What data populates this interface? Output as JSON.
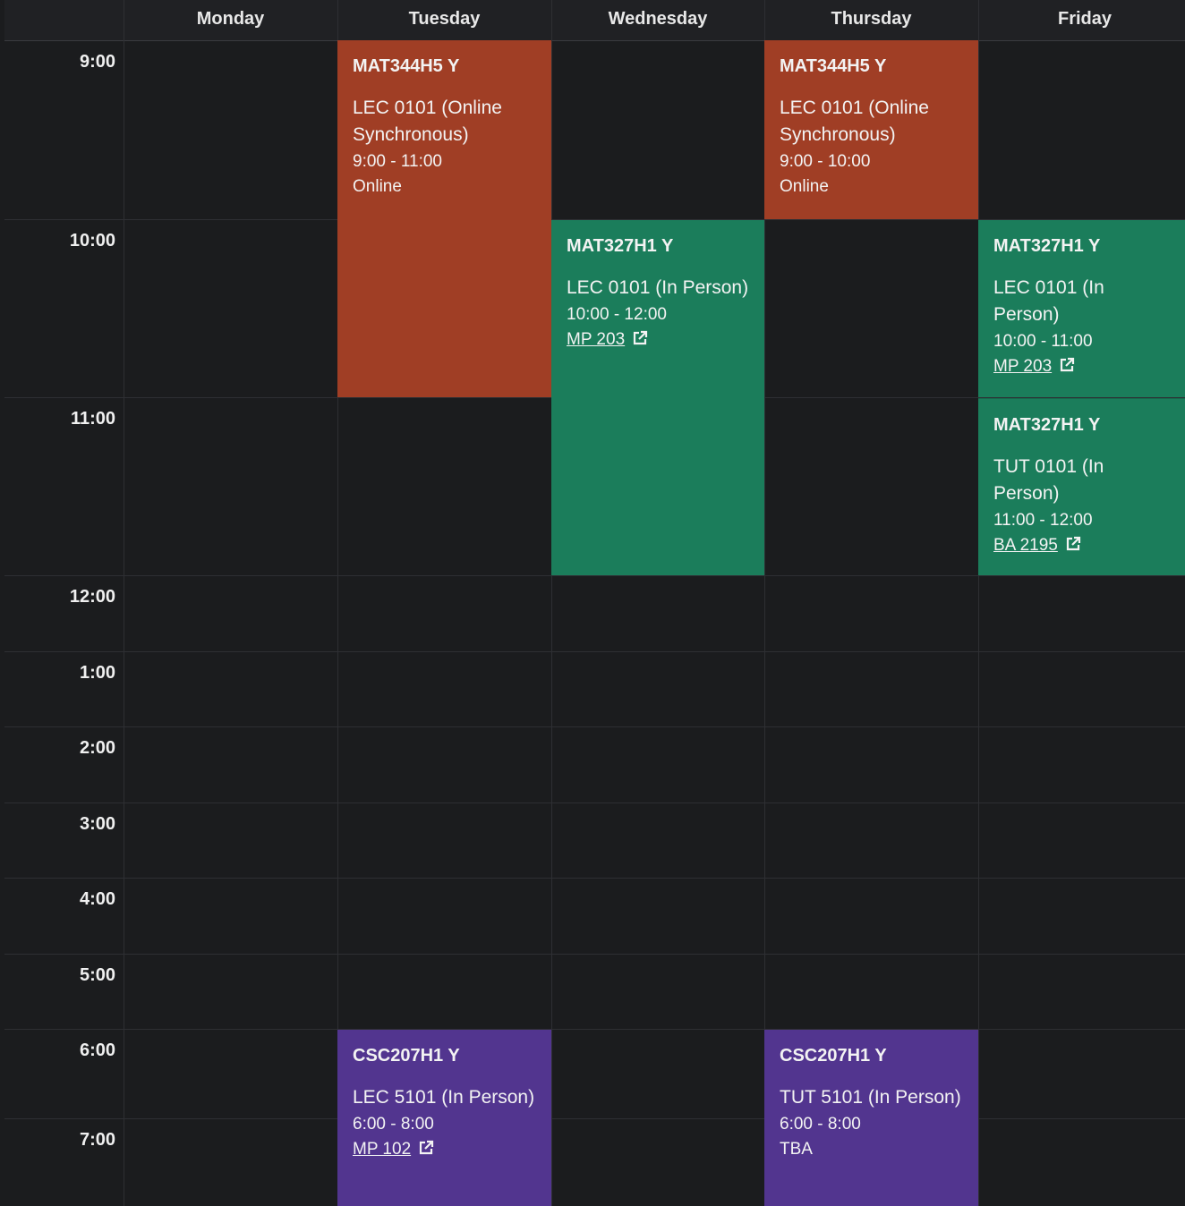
{
  "days": [
    "Monday",
    "Tuesday",
    "Wednesday",
    "Thursday",
    "Friday"
  ],
  "times": [
    "9:00",
    "10:00",
    "11:00",
    "12:00",
    "1:00",
    "2:00",
    "3:00",
    "4:00",
    "5:00",
    "6:00",
    "7:00"
  ],
  "colors": {
    "red": "#a03e25",
    "green": "#1b7d5b",
    "purple": "#52358f",
    "background": "#1b1c1e"
  },
  "events": [
    {
      "code": "MAT344H5 Y",
      "section": "LEC 0101 (Online Synchronous)",
      "time": "9:00 - 11:00",
      "location": "Online",
      "location_link": false,
      "day": "Tuesday"
    },
    {
      "code": "MAT344H5 Y",
      "section": "LEC 0101 (Online Synchronous)",
      "time": "9:00 - 10:00",
      "location": "Online",
      "location_link": false,
      "day": "Thursday"
    },
    {
      "code": "MAT327H1 Y",
      "section": "LEC 0101 (In Person)",
      "time": "10:00 - 12:00",
      "location": "MP 203",
      "location_link": true,
      "day": "Wednesday"
    },
    {
      "code": "MAT327H1 Y",
      "section": "LEC 0101 (In Person)",
      "time": "10:00 - 11:00",
      "location": "MP 203",
      "location_link": true,
      "day": "Friday"
    },
    {
      "code": "MAT327H1 Y",
      "section": "TUT 0101 (In Person)",
      "time": "11:00 - 12:00",
      "location": "BA 2195",
      "location_link": true,
      "day": "Friday"
    },
    {
      "code": "CSC207H1 Y",
      "section": "LEC 5101 (In Person)",
      "time": "6:00 - 8:00",
      "location": "MP 102",
      "location_link": true,
      "day": "Tuesday"
    },
    {
      "code": "CSC207H1 Y",
      "section": "TUT 5101 (In Person)",
      "time": "6:00 - 8:00",
      "location": "TBA",
      "location_link": false,
      "day": "Thursday"
    }
  ]
}
